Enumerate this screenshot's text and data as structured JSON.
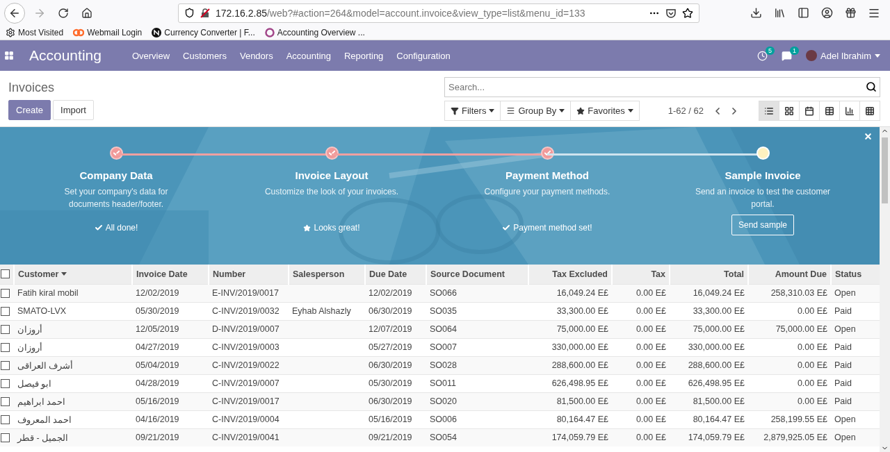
{
  "browser": {
    "url_host": "172.16.2.85",
    "url_path": "/web?#action=264&model=account.invoice&view_type=list&menu_id=133",
    "bookmarks": [
      {
        "label": "Most Visited"
      },
      {
        "label": "Webmail Login"
      },
      {
        "label": "Currency Converter | F..."
      },
      {
        "label": "Accounting Overview ..."
      }
    ]
  },
  "navbar": {
    "app_title": "Accounting",
    "menu": [
      {
        "label": "Overview"
      },
      {
        "label": "Customers"
      },
      {
        "label": "Vendors"
      },
      {
        "label": "Accounting"
      },
      {
        "label": "Reporting"
      },
      {
        "label": "Configuration"
      }
    ],
    "activity_count": "5",
    "message_count": "1",
    "user": "Adel Ibrahim"
  },
  "control_panel": {
    "breadcrumb": "Invoices",
    "buttons": [
      {
        "label": "Create",
        "kind": "primary"
      },
      {
        "label": "Import",
        "kind": "secondary"
      }
    ],
    "search": {
      "placeholder": "Search..."
    },
    "filters": [
      {
        "label": "Filters"
      },
      {
        "label": "Group By"
      },
      {
        "label": "Favorites"
      }
    ],
    "pager": "1-62 / 62",
    "views": [
      {
        "selected": true
      },
      {
        "selected": false
      },
      {
        "selected": false
      },
      {
        "selected": false
      },
      {
        "selected": false
      },
      {
        "selected": false
      }
    ]
  },
  "onboarding": {
    "steps": [
      {
        "title": "Company Data",
        "description": "Set your company's data for documents header/footer.",
        "done": true,
        "kind": "check",
        "result": "All done!"
      },
      {
        "title": "Invoice Layout",
        "description": "Customize the look of your invoices.",
        "done": true,
        "kind": "star",
        "result": "Looks great!"
      },
      {
        "title": "Payment Method",
        "description": "Configure your payment methods.",
        "done": true,
        "kind": "check",
        "result": "Payment method set!"
      },
      {
        "title": "Sample Invoice",
        "description": "Send an invoice to test the customer portal.",
        "done": false,
        "kind": "button",
        "result": "Send sample"
      }
    ]
  },
  "table": {
    "all_checked": false,
    "columns": [
      {
        "label": "Customer",
        "kind": "text",
        "sorted": true
      },
      {
        "label": "Invoice Date",
        "kind": "text",
        "sorted": false
      },
      {
        "label": "Number",
        "kind": "text",
        "sorted": false
      },
      {
        "label": "Salesperson",
        "kind": "text",
        "sorted": false
      },
      {
        "label": "Due Date",
        "kind": "text",
        "sorted": false
      },
      {
        "label": "Source Document",
        "kind": "text",
        "sorted": false
      },
      {
        "label": "Tax Excluded",
        "kind": "number",
        "sorted": false
      },
      {
        "label": "Tax",
        "kind": "number",
        "sorted": false
      },
      {
        "label": "Total",
        "kind": "number",
        "sorted": false
      },
      {
        "label": "Amount Due",
        "kind": "number",
        "sorted": false
      },
      {
        "label": "Status",
        "kind": "text",
        "sorted": false
      }
    ],
    "rows": [
      {
        "checked": false,
        "cells": [
          "Fatih kiral mobil",
          "12/02/2019",
          "E-INV/2019/0017",
          "",
          "12/02/2019",
          "SO066",
          "16,049.24 E£",
          "0.00 E£",
          "16,049.24 E£",
          "258,310.03 E£",
          "Open"
        ]
      },
      {
        "checked": false,
        "cells": [
          "SMATO-LVX",
          "05/30/2019",
          "C-INV/2019/0032",
          "Eyhab Alshazly",
          "06/30/2019",
          "SO035",
          "33,300.00 E£",
          "0.00 E£",
          "33,300.00 E£",
          "0.00 E£",
          "Paid"
        ]
      },
      {
        "checked": false,
        "cells": [
          "أروزان",
          "12/05/2019",
          "D-INV/2019/0007",
          "",
          "12/07/2019",
          "SO064",
          "75,000.00 E£",
          "0.00 E£",
          "75,000.00 E£",
          "75,000.00 E£",
          "Open"
        ]
      },
      {
        "checked": false,
        "cells": [
          "أروزان",
          "04/27/2019",
          "C-INV/2019/0003",
          "",
          "05/27/2019",
          "SO007",
          "330,000.00 E£",
          "0.00 E£",
          "330,000.00 E£",
          "0.00 E£",
          "Paid"
        ]
      },
      {
        "checked": false,
        "cells": [
          "أشرف العراقى",
          "05/04/2019",
          "C-INV/2019/0022",
          "",
          "06/30/2019",
          "SO028",
          "288,600.00 E£",
          "0.00 E£",
          "288,600.00 E£",
          "0.00 E£",
          "Paid"
        ]
      },
      {
        "checked": false,
        "cells": [
          "ابو فيصل",
          "04/28/2019",
          "C-INV/2019/0007",
          "",
          "05/30/2019",
          "SO011",
          "626,498.95 E£",
          "0.00 E£",
          "626,498.95 E£",
          "0.00 E£",
          "Paid"
        ]
      },
      {
        "checked": false,
        "cells": [
          "احمد ابراهيم",
          "05/16/2019",
          "C-INV/2019/0017",
          "",
          "06/30/2019",
          "SO020",
          "81,500.00 E£",
          "0.00 E£",
          "81,500.00 E£",
          "0.00 E£",
          "Paid"
        ]
      },
      {
        "checked": false,
        "cells": [
          "احمد المعروف",
          "04/16/2019",
          "C-INV/2019/0004",
          "",
          "05/16/2019",
          "SO006",
          "80,164.47 E£",
          "0.00 E£",
          "80,164.47 E£",
          "258,199.55 E£",
          "Open"
        ]
      },
      {
        "checked": false,
        "cells": [
          "الجميل - قطر",
          "09/21/2019",
          "C-INV/2019/0041",
          "",
          "09/21/2019",
          "SO054",
          "174,059.79 E£",
          "0.00 E£",
          "174,059.79 E£",
          "2,879,925.05 E£",
          "Open"
        ]
      }
    ]
  }
}
